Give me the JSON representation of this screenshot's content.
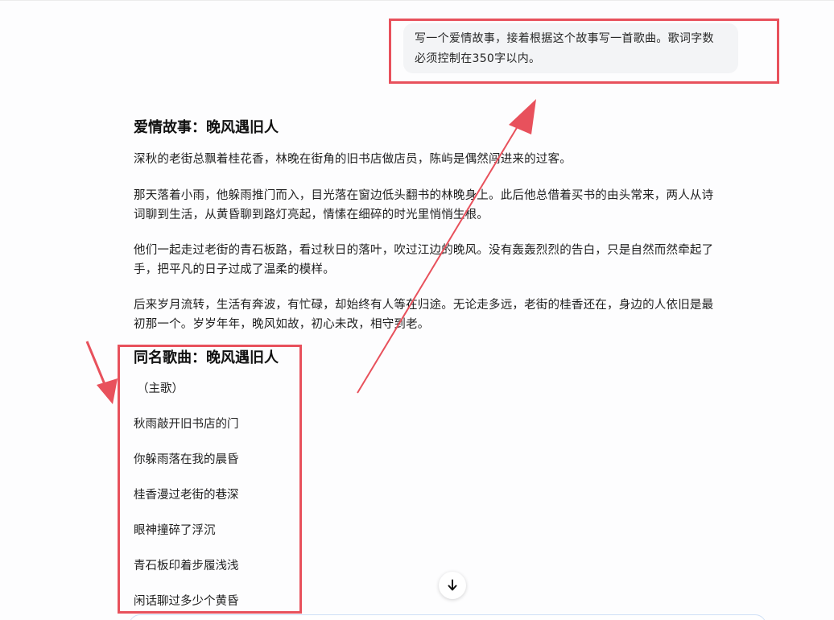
{
  "user_message": {
    "line1": "写一个爱情故事，接着根据这个故事写一首歌曲。歌词字数",
    "line2": "必须控制在350字以内。"
  },
  "story": {
    "title": "爱情故事：晚风遇旧人",
    "p1": "深秋的老街总飘着桂花香，林晚在街角的旧书店做店员，陈屿是偶然闯进来的过客。",
    "p2_line1": "那天落着小雨，他躲雨推门而入，目光落在窗边低头翻书的林晚身上。此后他总借着买书的由头常来，两人从诗",
    "p2_line2": "词聊到生活，从黄昏聊到路灯亮起，情愫在细碎的时光里悄悄生根。",
    "p3_line1": "他们一起走过老街的青石板路，看过秋日的落叶，吹过江边的晚风。没有轰轰烈烈的告白，只是自然而然牵起了",
    "p3_line2": "手，把平凡的日子过成了温柔的模样。",
    "p4_line1": "后来岁月流转，生活有奔波，有忙碌，却始终有人等在归途。无论走多远，老街的桂香还在，身边的人依旧是最",
    "p4_line2": "初那一个。岁岁年年，晚风如故，初心未改，相守到老。"
  },
  "song": {
    "title": "同名歌曲：晚风遇旧人",
    "section": "（主歌）",
    "lines": [
      "秋雨敲开旧书店的门",
      "你躲雨落在我的晨昏",
      "桂香漫过老街的巷深",
      "眼神撞碎了浮沉",
      "青石板印着步履浅浅",
      "闲话聊过多少个黄昏"
    ]
  },
  "colors": {
    "highlight": "#e8515c",
    "bubble": "#f3f4f6"
  },
  "icons": {
    "scroll_down": "arrow-down-icon"
  }
}
